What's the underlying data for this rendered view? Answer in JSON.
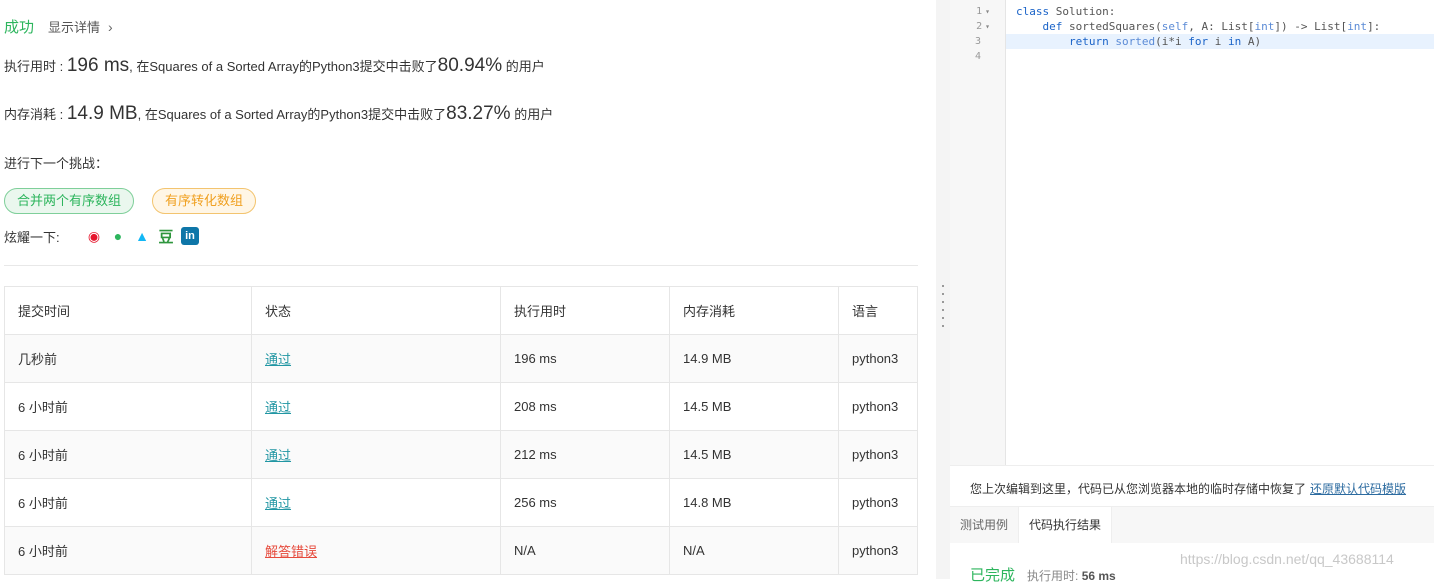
{
  "result": {
    "status": "成功",
    "detail_link": "显示详情",
    "runtime_label": "执行用时 : ",
    "runtime_value": "196 ms",
    "runtime_mid": ", 在Squares of a Sorted Array的Python3提交中击败了",
    "runtime_percent": "80.94%",
    "runtime_tail": " 的用户",
    "memory_label": "内存消耗 : ",
    "memory_value": "14.9 MB",
    "memory_mid": ", 在Squares of a Sorted Array的Python3提交中击败了",
    "memory_percent": "83.27%",
    "memory_tail": " 的用户",
    "next_label": "进行下一个挑战：",
    "challenges": [
      "合并两个有序数组",
      "有序转化数组"
    ],
    "share_label": "炫耀一下:",
    "share_icons": [
      "weibo-icon",
      "wechat-icon",
      "qq-icon",
      "douban-icon",
      "linkedin-icon"
    ]
  },
  "table": {
    "headers": [
      "提交时间",
      "状态",
      "执行用时",
      "内存消耗",
      "语言"
    ],
    "rows": [
      {
        "time": "几秒前",
        "status": "通过",
        "status_kind": "pass",
        "runtime": "196 ms",
        "memory": "14.9 MB",
        "lang": "python3"
      },
      {
        "time": "6 小时前",
        "status": "通过",
        "status_kind": "pass",
        "runtime": "208 ms",
        "memory": "14.5 MB",
        "lang": "python3"
      },
      {
        "time": "6 小时前",
        "status": "通过",
        "status_kind": "pass",
        "runtime": "212 ms",
        "memory": "14.5 MB",
        "lang": "python3"
      },
      {
        "time": "6 小时前",
        "status": "通过",
        "status_kind": "pass",
        "runtime": "256 ms",
        "memory": "14.8 MB",
        "lang": "python3"
      },
      {
        "time": "6 小时前",
        "status": "解答错误",
        "status_kind": "fail",
        "runtime": "N/A",
        "memory": "N/A",
        "lang": "python3"
      }
    ]
  },
  "editor": {
    "line_numbers": [
      "1",
      "2",
      "3",
      "4"
    ],
    "lines": [
      "class Solution:",
      "    def sortedSquares(self, A: List[int]) -> List[int]:",
      "        return sorted(i*i for i in A)",
      ""
    ]
  },
  "bottom": {
    "restore_note": "您上次编辑到这里，代码已从您浏览器本地的临时存储中恢复了",
    "restore_link": "还原默认代码模版",
    "tab_test": "测试用例",
    "tab_result": "代码执行结果",
    "done": "已完成",
    "runtime_label": "执行用时: ",
    "runtime_value": "56 ms"
  },
  "watermark": "https://blog.csdn.net/qq_43688114",
  "colors": {
    "success": "#2db55d",
    "warning": "#f0a020",
    "link": "#2196a3",
    "error": "#e64a3c"
  }
}
